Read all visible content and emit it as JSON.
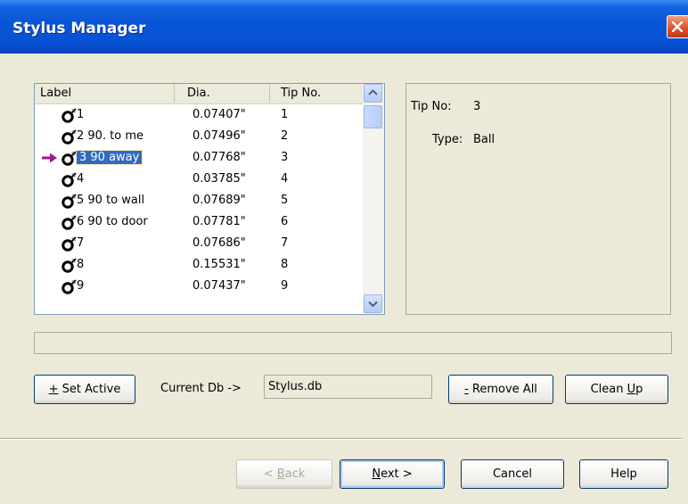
{
  "window": {
    "title": "Stylus Manager"
  },
  "list": {
    "columns": [
      "Label",
      "Dia.",
      "Tip No."
    ],
    "rows": [
      {
        "label": "1",
        "dia": "0.07407\"",
        "tip": "1"
      },
      {
        "label": "2 90. to me",
        "dia": "0.07496\"",
        "tip": "2"
      },
      {
        "label": "3 90 away",
        "dia": "0.07768\"",
        "tip": "3",
        "selected": true,
        "active": true
      },
      {
        "label": "4",
        "dia": "0.03785\"",
        "tip": "4"
      },
      {
        "label": "5 90 to wall",
        "dia": "0.07689\"",
        "tip": "5"
      },
      {
        "label": "6 90  to door",
        "dia": "0.07781\"",
        "tip": "6"
      },
      {
        "label": "7",
        "dia": "0.07686\"",
        "tip": "7"
      },
      {
        "label": "8",
        "dia": "0.15531\"",
        "tip": "8"
      },
      {
        "label": "9",
        "dia": "0.07437\"",
        "tip": "9"
      }
    ]
  },
  "info": {
    "tip_no_label": "Tip No:",
    "tip_no_value": "3",
    "type_label": "Type:",
    "type_value": "Ball"
  },
  "actions": {
    "set_active_prefix": "+",
    "set_active_label": " Set Active",
    "current_db_label": "Current Db ->",
    "current_db_value": "Stylus.db",
    "remove_all_prefix": "-",
    "remove_all_label": " Remove All",
    "clean_up_pre": "Clean ",
    "clean_up_key": "U",
    "clean_up_post": "p"
  },
  "nav": {
    "back_pre": "< ",
    "back_key": "B",
    "back_post": "ack",
    "next_key": "N",
    "next_post": "ext >",
    "cancel": "Cancel",
    "help": "Help"
  },
  "colors": {
    "titlebar": "#0a56d8",
    "selection": "#316ac5",
    "active_arrow": "#9b1d8a",
    "close": "#d9502a"
  },
  "icons": {
    "close": "close-icon",
    "tip": "stylus-tip-icon",
    "active": "active-arrow-icon",
    "up": "chevron-up-icon",
    "down": "chevron-down-icon"
  }
}
